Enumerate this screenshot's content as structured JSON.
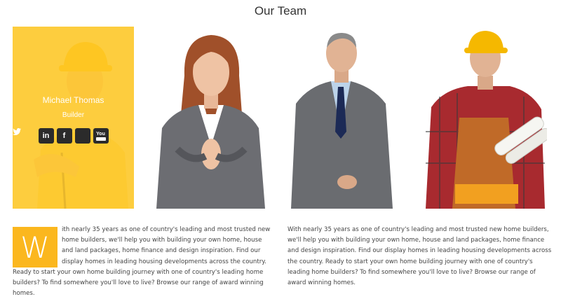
{
  "section": {
    "title": "Our Team"
  },
  "featured_member": {
    "name": "Michael Thomas",
    "role": "Builder",
    "overlay_color": "#fbb71e",
    "socials": [
      {
        "icon": "linkedin-icon",
        "glyph": "in"
      },
      {
        "icon": "facebook-icon",
        "glyph": "f"
      },
      {
        "icon": "twitter-icon",
        "glyph": "t"
      },
      {
        "icon": "youtube-icon",
        "glyph": "You"
      }
    ]
  },
  "members": [
    {
      "photo": "builder-hardhat-photo"
    },
    {
      "photo": "businesswoman-photo"
    },
    {
      "photo": "businessman-photo"
    },
    {
      "photo": "construction-worker-photo"
    }
  ],
  "about": {
    "dropcap": "W",
    "paragraph1": "ith nearly 35 years as one of country's leading and most trusted new home builders, we'll help you with building your own home, house and land packages, home finance and design inspiration. Find our display homes in leading housing developments across the country. Ready to start your own home building journey with one of country's leading home builders? To find somewhere you'll love to live? Browse our range of award winning homes.",
    "paragraph2": "With nearly 35 years as one of country's leading and most trusted new home builders, we'll help you with building your own home, house and land packages, home finance and design inspiration. Find our display homes in leading housing developments across the country. Ready to start your own home building journey with one of country's leading home builders? To find somewhere you'll love to live? Browse our range of award winning homes."
  }
}
